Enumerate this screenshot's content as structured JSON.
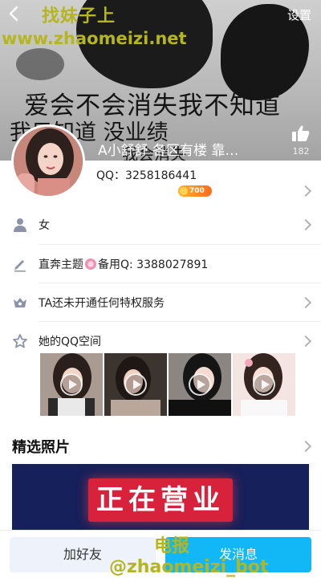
{
  "header": {
    "back_icon": "chevron-left-icon",
    "settings_label": "设置",
    "cover_text": [
      "爱会不会消失我不知道",
      "我只知道 没业绩",
      "我会消失"
    ],
    "nickname": "A小舒舒 各区有楼 靠…",
    "like_icon": "thumbs-up-icon",
    "like_count": "182"
  },
  "watermarks": {
    "top_line1": "找妹子上",
    "top_line2": "www.zhaomeizi.net",
    "bottom_line1": "电报",
    "bottom_line2": "@zhaomeizi_bot"
  },
  "profile": {
    "qq_label": "QQ：",
    "qq_number": "3258186441",
    "vip_level": "700"
  },
  "rows": [
    {
      "icon": "person-icon",
      "text": "女"
    },
    {
      "icon": "pencil-icon",
      "text_before": "直奔主题",
      "flower_icon": "flower-icon",
      "text_after": "备用Q: 3388027891"
    },
    {
      "icon": "crown-icon",
      "text": "TA还未开通任何特权服务"
    },
    {
      "icon": "star-icon",
      "text": "她的QQ空间"
    }
  ],
  "qzone_photos": [
    "photo-1",
    "photo-2",
    "photo-3",
    "photo-4"
  ],
  "featured": {
    "title": "精选照片",
    "sign_text": "正在营业"
  },
  "actions": {
    "add_friend": "加好友",
    "send_message": "发消息"
  },
  "colors": {
    "accent": "#12b7f5",
    "watermark": "#b5b51d",
    "vip": "#ff8a1f"
  }
}
